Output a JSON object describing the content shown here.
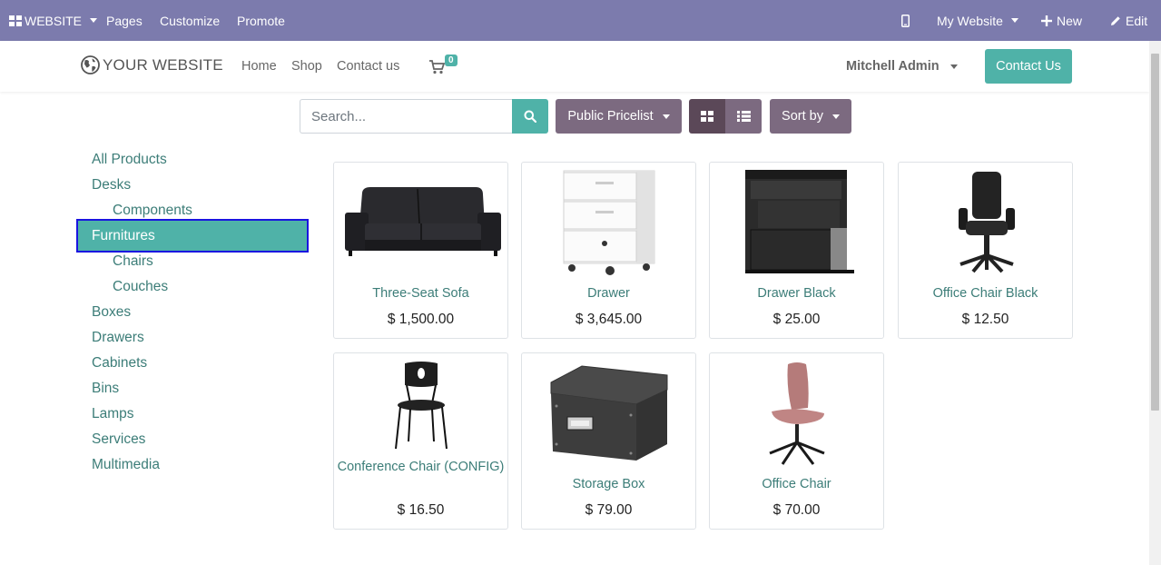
{
  "adminbar": {
    "website_label": "WEBSITE",
    "pages_label": "Pages",
    "customize_label": "Customize",
    "promote_label": "Promote",
    "mywebsite_label": "My Website",
    "new_label": "New",
    "edit_label": "Edit",
    "bg_color": "#7c7bad"
  },
  "header": {
    "logo_text": "YOUR WEBSITE",
    "nav": [
      "Home",
      "Shop",
      "Contact us"
    ],
    "cart_count": "0",
    "user_name": "Mitchell Admin",
    "contact_button": "Contact Us",
    "accent_color": "#4fb2a8"
  },
  "toolbar": {
    "search_placeholder": "Search...",
    "pricelist_label": "Public Pricelist",
    "sortby_label": "Sort by",
    "view_grid": "grid-icon",
    "view_list": "list-icon"
  },
  "categories": {
    "all_products": "All Products",
    "desks": "Desks",
    "components": "Components",
    "furnitures": "Furnitures",
    "chairs": "Chairs",
    "couches": "Couches",
    "boxes": "Boxes",
    "drawers": "Drawers",
    "cabinets": "Cabinets",
    "bins": "Bins",
    "lamps": "Lamps",
    "services": "Services",
    "multimedia": "Multimedia",
    "active": "Furnitures"
  },
  "products": [
    {
      "name": "Three-Seat Sofa",
      "price": "$ 1,500.00",
      "icon": "sofa-image"
    },
    {
      "name": "Drawer",
      "price": "$ 3,645.00",
      "icon": "drawer-image"
    },
    {
      "name": "Drawer Black",
      "price": "$ 25.00",
      "icon": "drawer-black-image"
    },
    {
      "name": "Office Chair Black",
      "price": "$ 12.50",
      "icon": "office-chair-black-image"
    },
    {
      "name": "Conference Chair (CONFIG)",
      "price": "$ 16.50",
      "icon": "conference-chair-image"
    },
    {
      "name": "Storage Box",
      "price": "$ 79.00",
      "icon": "storage-box-image"
    },
    {
      "name": "Office Chair",
      "price": "$ 70.00",
      "icon": "office-chair-image"
    }
  ]
}
